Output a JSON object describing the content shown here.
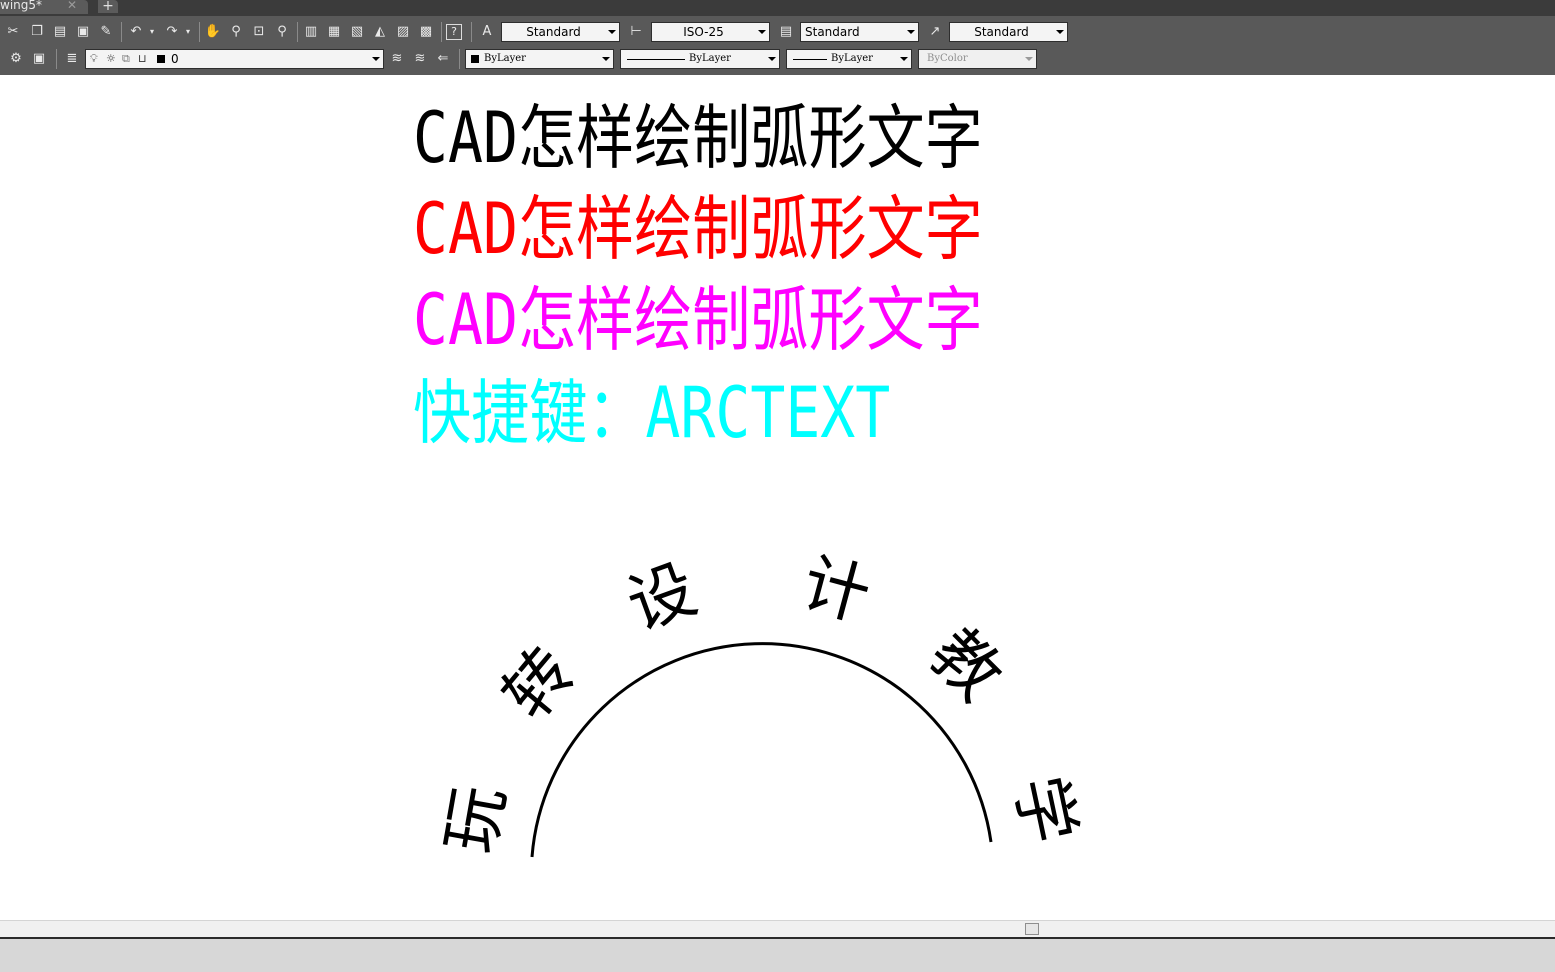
{
  "window": {
    "tab_title": "wing5*",
    "tab_close_icon": "close-icon",
    "new_tab_label": "+"
  },
  "toolbar": {
    "row1_icons": [
      "cut-icon",
      "copy-icon",
      "paste-icon",
      "match-properties-icon",
      "block-editor-icon",
      "undo-icon",
      "redo-icon",
      "pan-icon",
      "zoom-realtime-icon",
      "zoom-window-icon",
      "zoom-previous-icon",
      "properties-icon",
      "design-center-icon",
      "tool-palettes-icon",
      "sheet-set-icon",
      "markup-icon",
      "calculator-icon",
      "help-icon"
    ],
    "text_style_value": "Standard",
    "dim_style_value": "ISO-25",
    "table_style_value": "Standard",
    "multileader_style_value": "Standard",
    "layer_value": "0",
    "color_value": "ByLayer",
    "linetype_value": "ByLayer",
    "lineweight_value": "ByLayer",
    "plotstyle_value": "ByColor"
  },
  "drawing": {
    "line1": {
      "cjk": "怎样绘制弧形文字",
      "latin": "CAD",
      "color": "#000000"
    },
    "line2": {
      "cjk": "怎样绘制弧形文字",
      "latin": "CAD",
      "color": "#ff0000"
    },
    "line3": {
      "cjk": "怎样绘制弧形文字",
      "latin": "CAD",
      "color": "#ff00ff"
    },
    "line4": {
      "prefix": "快捷键：",
      "command": "ARCTEXT",
      "color": "#00ffff"
    },
    "arc_text": {
      "chars": [
        "玩",
        "转",
        "设",
        "计",
        "教",
        "学"
      ],
      "color": "#000000"
    }
  }
}
